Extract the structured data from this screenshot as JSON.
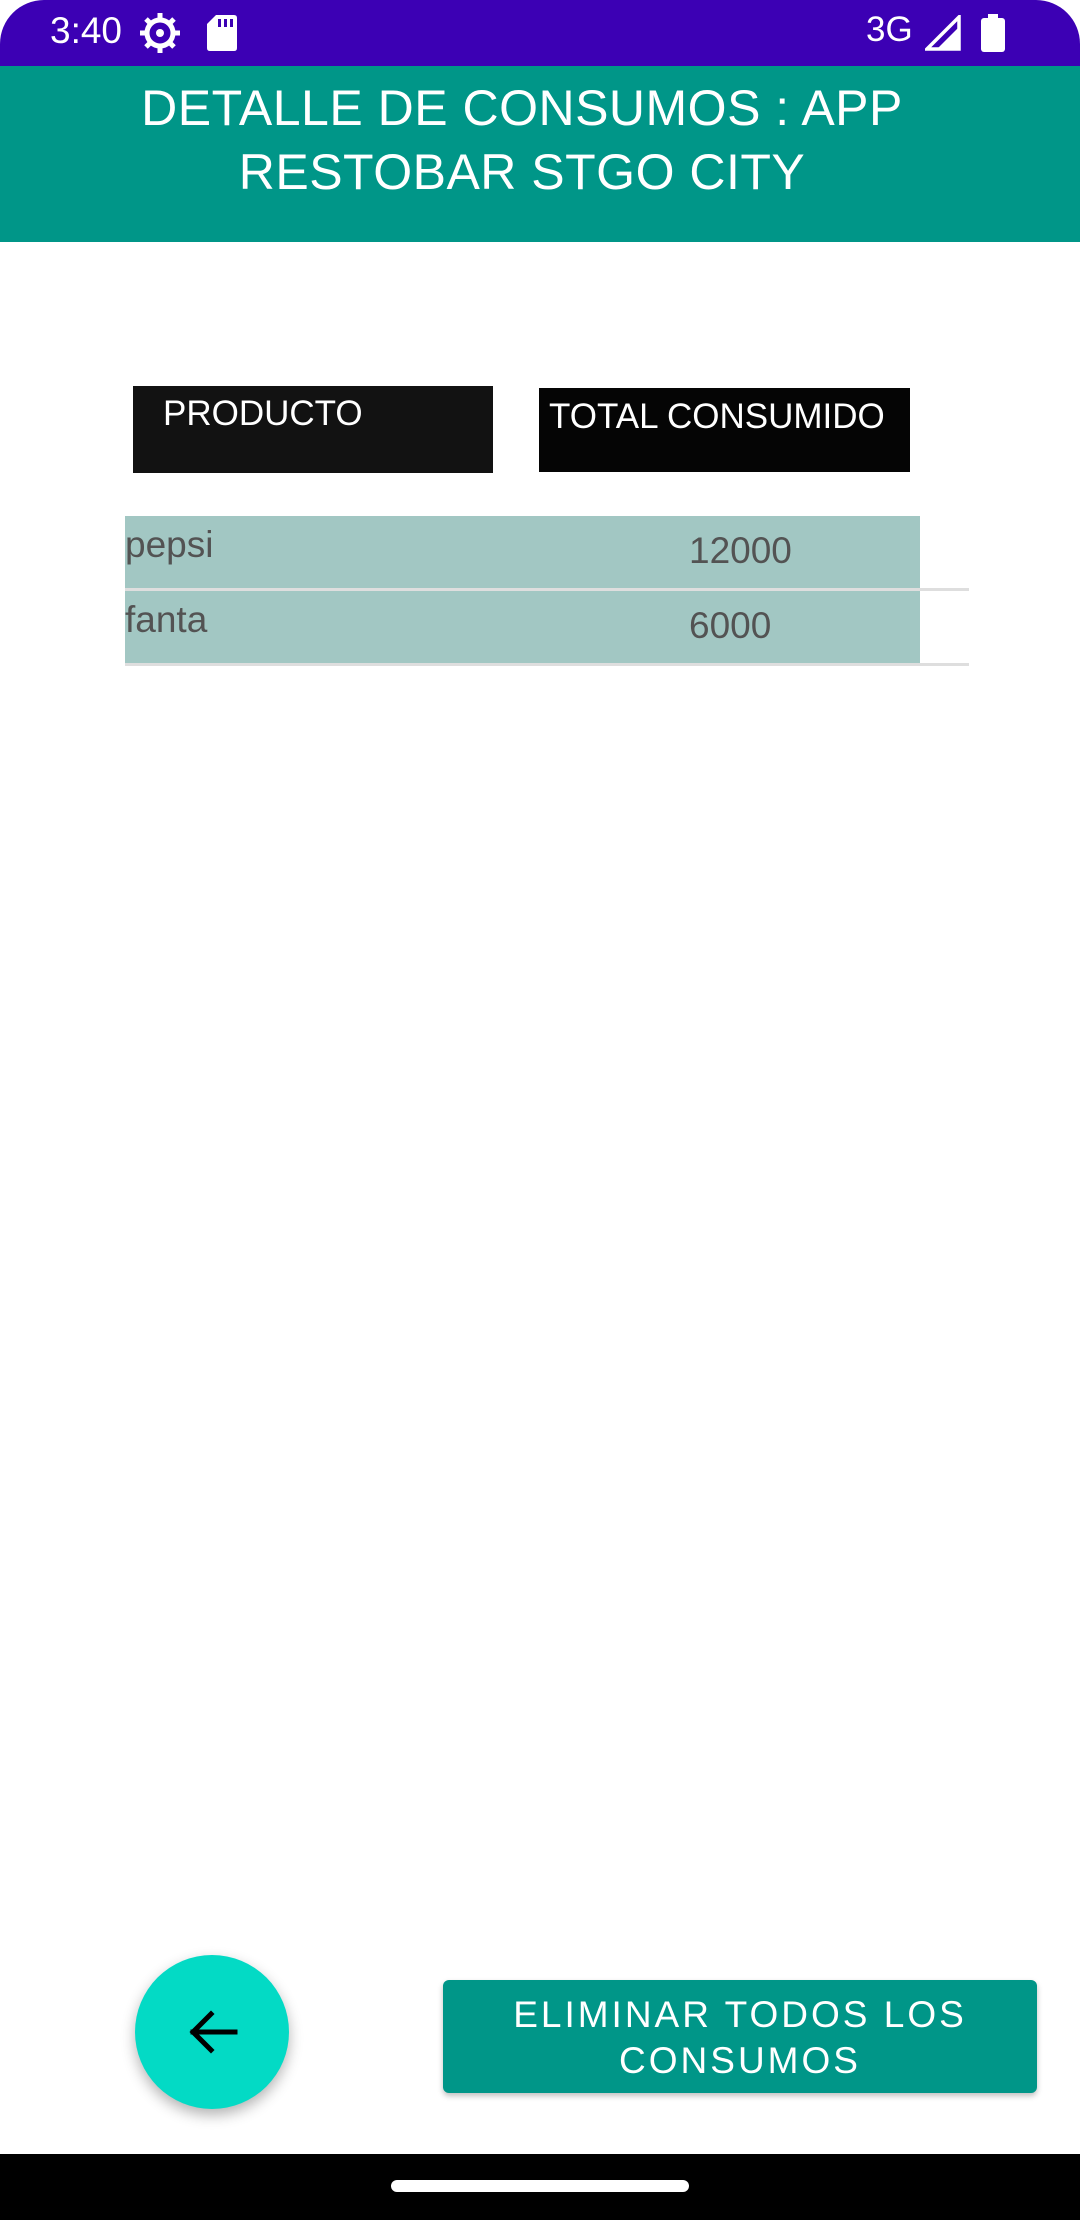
{
  "status_bar": {
    "time": "3:40",
    "network": "3G",
    "icons": [
      "settings-gear-icon",
      "sd-card-icon",
      "signal-icon",
      "battery-icon"
    ]
  },
  "header": {
    "title": "DETALLE DE CONSUMOS : APP RESTOBAR STGO CITY",
    "background_color": "#009688"
  },
  "table": {
    "columns": [
      "PRODUCTO",
      "TOTAL CONSUMIDO"
    ],
    "rows": [
      {
        "product": "pepsi",
        "total": "12000"
      },
      {
        "product": "fanta",
        "total": "6000"
      }
    ],
    "row_color": "#a2c7c3"
  },
  "actions": {
    "back_icon": "arrow-left-icon",
    "back_fab_color": "#03dac5",
    "delete_all_label": "ELIMINAR TODOS LOS CONSUMOS"
  },
  "colors": {
    "status_bar": "#3c00b4",
    "accent": "#009688"
  }
}
